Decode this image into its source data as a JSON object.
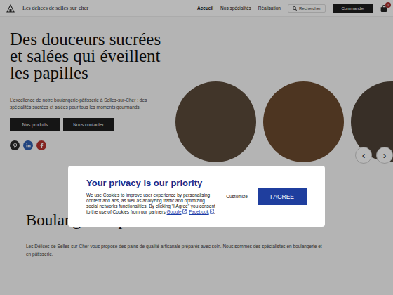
{
  "header": {
    "logo": "Les délices de selles-sur-cher",
    "nav": [
      {
        "label": "Accueil",
        "selected": true
      },
      {
        "label": "Nos spécialités",
        "selected": false
      },
      {
        "label": "Réalisation",
        "selected": false
      }
    ],
    "search": "Rechercher",
    "button": "Commander",
    "cart_badge": "0"
  },
  "hero": {
    "title": "Des douceurs sucrées et salées qui éveillent les papilles",
    "text": "L'excellence de notre boulangerie-pâtisserie à Selles-sur-Cher : des spécialités sucrées et salées pour tous les moments gourmands.",
    "buttons": [
      "Nos produits",
      "Nous contacter"
    ],
    "socials": [
      {
        "color": "#2a2a2a"
      },
      {
        "color": "#2f5fb0"
      },
      {
        "color": "#b8322f"
      }
    ],
    "prev": "‹",
    "next": "›"
  },
  "section": {
    "title": "Boulangerie - pâtisserie à Selles-sur-Cher",
    "text": "Les Délices de Selles-sur-Cher vous propose des pains de qualité artisanale préparés avec soin. Nous sommes des spécialistes en boulangerie et en pâtisserie."
  },
  "cookie": {
    "title": "Your privacy is our priority",
    "text": "We use Cookies to improve user experience by personalising content and ads, as well as analyzing traffic and optimizing social networks functionalities. By clicking \"I Agree\" you consent to the use of Cookies from our partners ",
    "links": [
      {
        "label": "Google",
        "after": ", "
      },
      {
        "label": "Facebook",
        "after": "."
      }
    ],
    "customize": "Customize",
    "agree": "I AGREE"
  }
}
